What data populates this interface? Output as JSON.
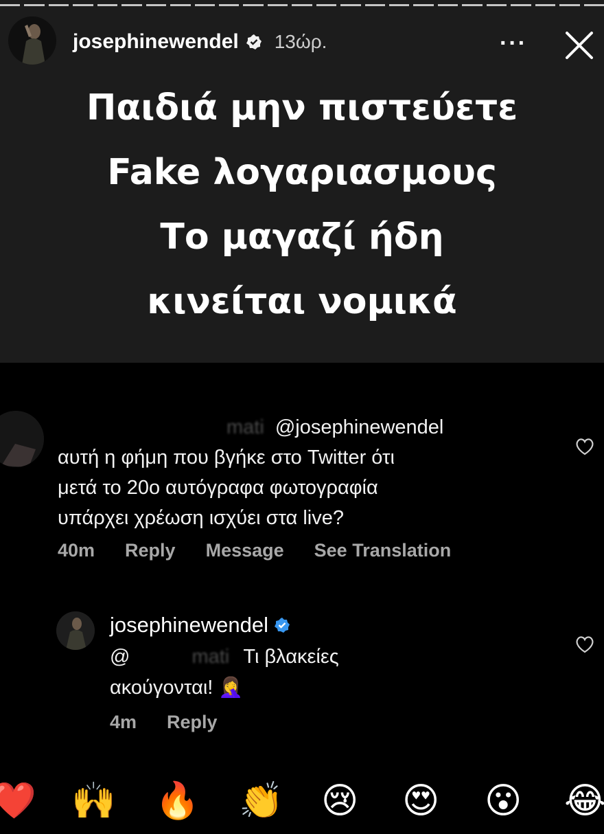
{
  "story": {
    "username": "josephinewendel",
    "time": "13ώρ.",
    "more_label": "···",
    "headline": [
      "Παιδιά μην πιστεύετε",
      "Fake λογαριασμους",
      "Το μαγαζί ήδη",
      "κινείται νομικά"
    ]
  },
  "comments": [
    {
      "username_blurred": "mati",
      "mention": "@josephinewendel",
      "lines": [
        "αυτή η φήμη που βγήκε στο Twitter ότι",
        "μετά το 20ο αυτόγραφα φωτογραφία",
        "υπάρχει χρέωση ισχύει στα live?"
      ],
      "time": "40m",
      "reply_label": "Reply",
      "message_label": "Message",
      "translate_label": "See Translation"
    },
    {
      "username": "josephinewendel",
      "mention_prefix": "@",
      "mention_blurred": "mati",
      "line1_text": "Τι βλακείες",
      "line2_text": "ακούγονται!",
      "line2_emoji": "🤦‍♀️",
      "time": "4m",
      "reply_label": "Reply"
    }
  ],
  "reactions": [
    "❤️",
    "🙌",
    "🔥",
    "👏",
    "😢",
    "😍",
    "😮",
    "😂"
  ],
  "colors": {
    "story_bg": "#1c1c1c",
    "page_bg": "#000000",
    "verified": "#3897f0",
    "meta_text": "#a8a8a8"
  }
}
